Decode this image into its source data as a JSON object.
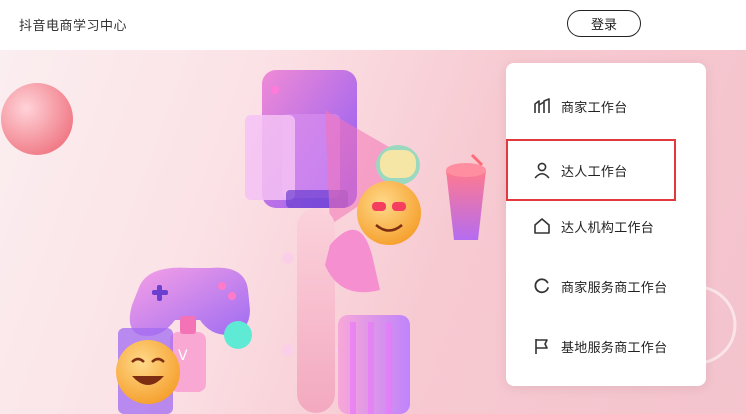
{
  "header": {
    "site_title": "抖音电商学习中心",
    "login_label": "登录"
  },
  "panel": {
    "items": [
      {
        "label": "商家工作台",
        "icon": "shop-stats-icon"
      },
      {
        "label": "达人工作台",
        "icon": "person-icon",
        "highlighted": true
      },
      {
        "label": "达人机构工作台",
        "icon": "house-icon"
      },
      {
        "label": "商家服务商工作台",
        "icon": "refresh-circle-icon"
      },
      {
        "label": "基地服务商工作台",
        "icon": "flag-icon"
      }
    ]
  },
  "colors": {
    "highlight_border": "#e0393e",
    "hero_bg": "#f7c9d1"
  }
}
